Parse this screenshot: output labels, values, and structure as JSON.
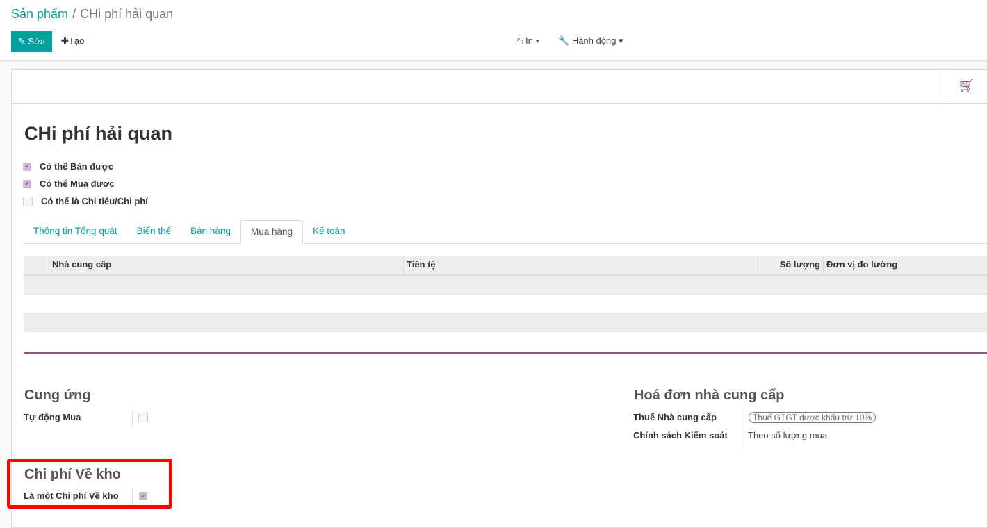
{
  "breadcrumb": {
    "parent": "Sản phẩm",
    "separator": "/",
    "current": "CHi phí hải quan"
  },
  "toolbar": {
    "edit": "Sửa",
    "create": "Tạo",
    "print": "In",
    "action": "Hành động"
  },
  "form": {
    "title": "CHi phí hải quan",
    "checkboxes": [
      {
        "label": "Có thể Bán được",
        "checked": true
      },
      {
        "label": "Có thể Mua được",
        "checked": true
      },
      {
        "label": "Có thể là Chi tiêu/Chi phí",
        "checked": false
      }
    ],
    "tabs": [
      {
        "label": "Thông tin Tổng quát"
      },
      {
        "label": "Biến thể"
      },
      {
        "label": "Bán hàng"
      },
      {
        "label": "Mua hàng",
        "active": true
      },
      {
        "label": "Kế toán"
      }
    ],
    "table": {
      "columns": [
        "Nhà cung cấp",
        "Tiền tệ",
        "Số lượng",
        "Đơn vị đo lường"
      ]
    },
    "procurement": {
      "title": "Cung ứng",
      "auto_buy_label": "Tự động Mua",
      "auto_buy": false
    },
    "vendor_bill": {
      "title": "Hoá đơn nhà cung cấp",
      "tax_label": "Thuế Nhà cung cấp",
      "tax_value": "Thuế GTGT được khấu trừ 10%",
      "policy_label": "Chính sách Kiểm soát",
      "policy_value": "Theo số lượng mua"
    },
    "landed": {
      "title": "Chi phí Về kho",
      "label": "Là một Chi phí Về kho",
      "checked": true
    }
  },
  "colors": {
    "accent": "#00a09d",
    "brand": "#875a7b",
    "highlight": "#ff0000"
  }
}
